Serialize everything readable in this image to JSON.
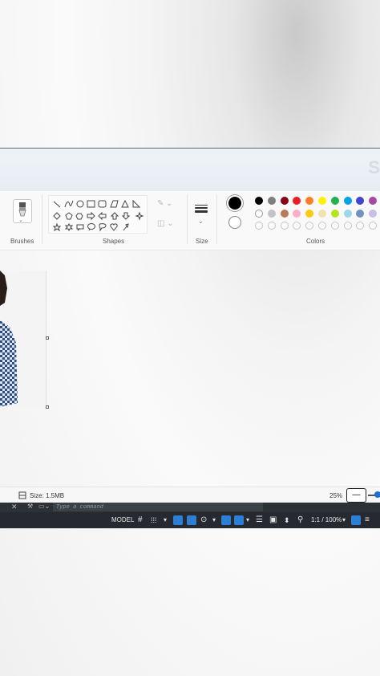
{
  "window": {
    "title_fragment": "Sl"
  },
  "ribbon": {
    "brushes_label": "Brushes",
    "shapes_label": "Shapes",
    "size_label": "Size",
    "colors_label": "Colors",
    "current_colors": {
      "color1": "#000000",
      "color2": "#ffffff"
    },
    "palette_row1": [
      "#000000",
      "#7f7f7f",
      "#880015",
      "#ed1c24",
      "#ff7f27",
      "#fff200",
      "#22b14c",
      "#00a2e8",
      "#3f48cc",
      "#a349a4"
    ],
    "palette_row2": [
      "#ffffff",
      "#c3c3c3",
      "#b97a57",
      "#ffaec9",
      "#ffc90e",
      "#efe4b0",
      "#b5e61d",
      "#99d9ea",
      "#7092be",
      "#c8bfe7"
    ]
  },
  "status": {
    "size_text": "Size: 1.5MB",
    "zoom_text": "25%",
    "zoom_button": "—"
  },
  "cad": {
    "command_placeholder": "Type a command",
    "model_label": "MODEL",
    "scale_label": "1:1 / 100%"
  }
}
